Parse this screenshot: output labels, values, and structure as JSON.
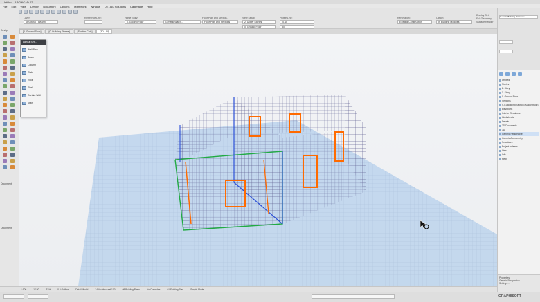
{
  "window": {
    "title": "Untitled - ARCHICAD 22"
  },
  "menu": [
    "File",
    "Edit",
    "View",
    "Design",
    "Document",
    "Options",
    "Teamwork",
    "Window",
    "DETAIL Solutions",
    "Cadimage",
    "Help"
  ],
  "toolbar": {
    "layer_label": "Layer:",
    "layer_value": "Structural - Bearing",
    "reference_label": "Reference Line:",
    "floor_label": "Home Story:",
    "floor_value": "0. Ground Floor",
    "composite_value": "Generic Wall/S...",
    "floor_plan_label": "Floor Plan and Section...",
    "floor_plan_value": "Floor Plan and Sections",
    "view_label": "View Setup:",
    "view_value": "0. Ground Floor",
    "story_value": "2. Upper Stories",
    "profile_label": "Profile Line:",
    "elevation_value": "-0.15",
    "thickness_value": "30",
    "renovation_label": "Renovation:",
    "renovation_value": "Existing Construction",
    "option_label": "Option:",
    "option_value": "In Building Modules",
    "display_label": "Display Set:",
    "display_value": "Full Geometry",
    "display_value2": "Surface Render",
    "override_value": "Generic Building Paramete..."
  },
  "tabs": [
    "[0. Ground Floor]",
    "[0. Building Stories]",
    "[Section Cuts]",
    "[3D / All]"
  ],
  "toolbox": {
    "select_label": "Design",
    "document_label": "Document",
    "more_label": "Document"
  },
  "palette": {
    "title": "Layout Sett...",
    "items": [
      "Wall Plan",
      "Beam",
      "Column",
      "Slab",
      "Roof",
      "Shell",
      "Curtain Wall",
      "Stair"
    ]
  },
  "right_panel": {
    "tree": [
      {
        "label": "Untitled",
        "sel": false
      },
      {
        "label": "Stories",
        "sel": false
      },
      {
        "label": "2. Story",
        "sel": false
      },
      {
        "label": "1. Story",
        "sel": false
      },
      {
        "label": "0. Ground Floor",
        "sel": false
      },
      {
        "label": "Sections",
        "sel": false
      },
      {
        "label": "S-01 Building Section (Auto-rebuild)",
        "sel": false
      },
      {
        "label": "Elevations",
        "sel": false
      },
      {
        "label": "Interior Elevations",
        "sel": false
      },
      {
        "label": "Worksheets",
        "sel": false
      },
      {
        "label": "Details",
        "sel": false
      },
      {
        "label": "3D Documents",
        "sel": false
      },
      {
        "label": "3D",
        "sel": false
      },
      {
        "label": "Generic Perspective",
        "sel": true
      },
      {
        "label": "Generic Axonometry",
        "sel": false
      },
      {
        "label": "Schedules",
        "sel": false
      },
      {
        "label": "Project Indexes",
        "sel": false
      },
      {
        "label": "Lists",
        "sel": false
      },
      {
        "label": "Info",
        "sel": false
      },
      {
        "label": "Help",
        "sel": false
      }
    ],
    "bottom_label": "Properties",
    "bottom_value": "Generic Perspective",
    "bottom_value2": "Settings..."
  },
  "statusbar": [
    "1:100",
    "1:100",
    "33%",
    "0.0 Outline",
    "Detail Model",
    "24 Architectural 100",
    "08 Building Plans",
    "No Overrides",
    "01 Existing Plan",
    "Simple Model"
  ],
  "brand": "GRAPHISOFT",
  "colors": {
    "wall_grid": "#5b5b8f",
    "opening": "#ff6a00",
    "selection_green": "#22aa44",
    "ground": "#bcd3ec"
  }
}
